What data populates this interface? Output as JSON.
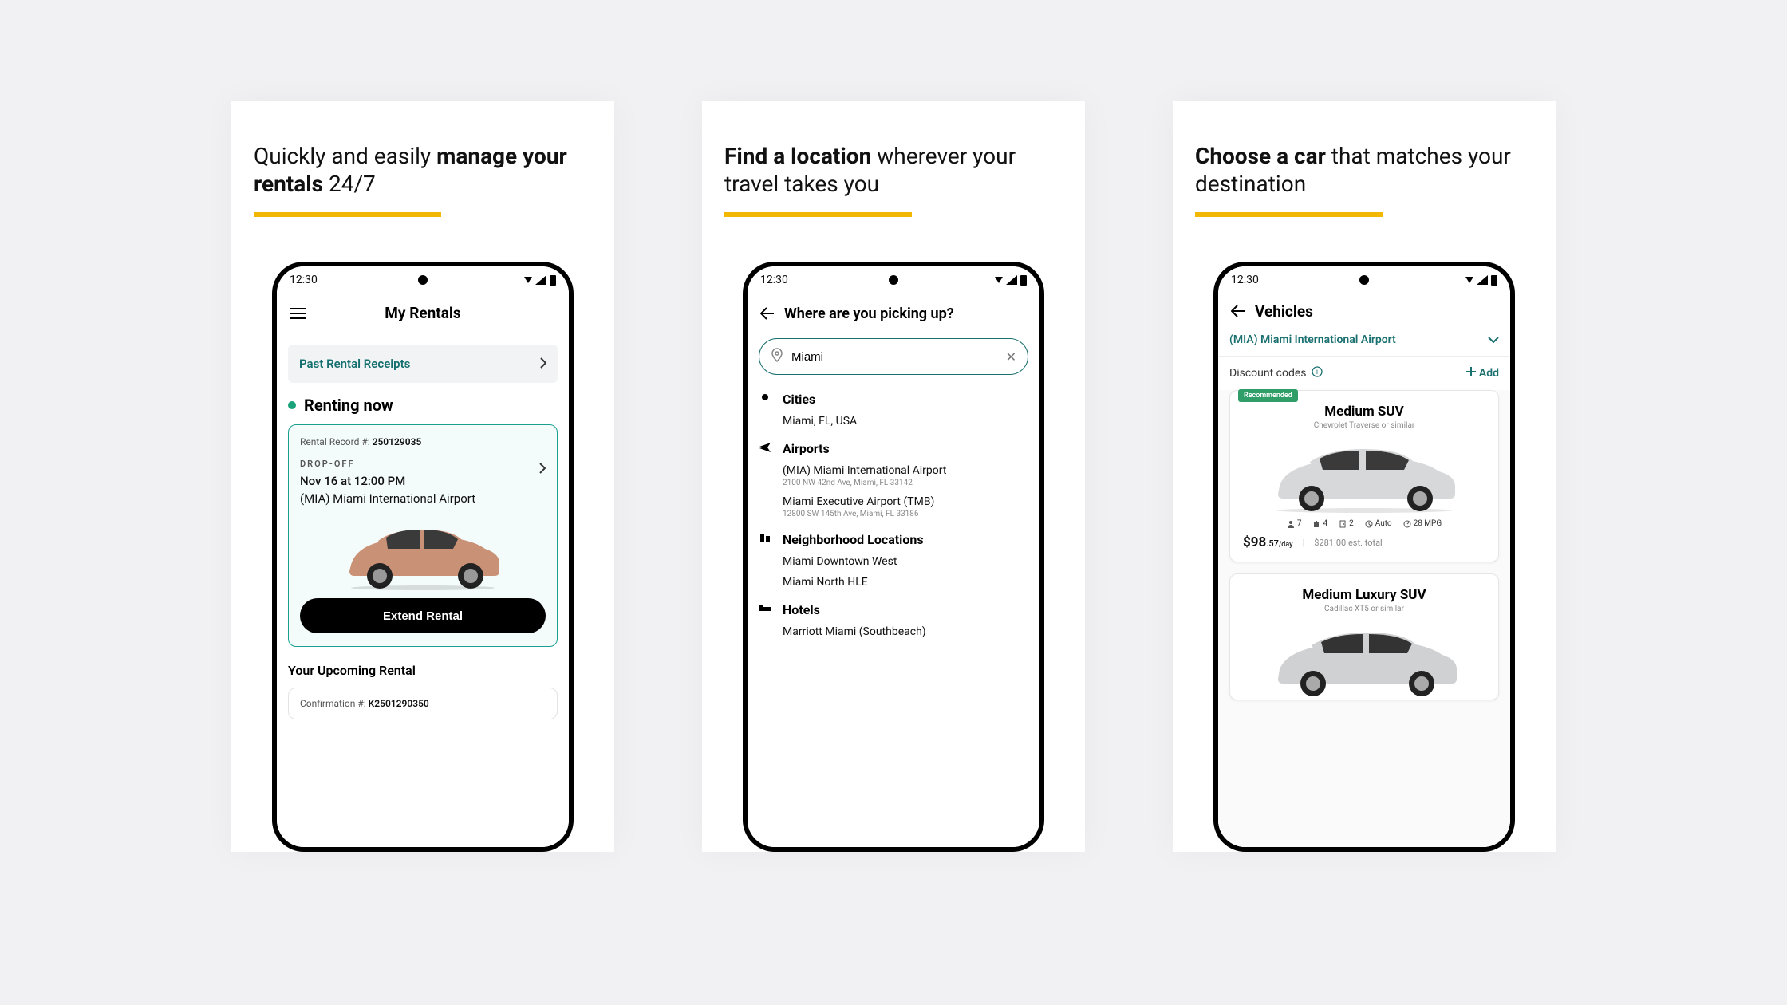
{
  "shared": {
    "statusbar_time": "12:30"
  },
  "panel1": {
    "headline_pre": "Quickly and easily ",
    "headline_bold": "manage your rentals",
    "headline_post": " 24/7",
    "screen": {
      "title": "My Rentals",
      "past_receipts": "Past Rental Receipts",
      "renting_now": "Renting now",
      "record_label": "Rental Record #: ",
      "record_num": "250129035",
      "dropoff_label": "DROP-OFF",
      "dropoff_when": "Nov 16 at 12:00 PM",
      "dropoff_loc": "(MIA) Miami International Airport",
      "extend_btn": "Extend Rental",
      "upcoming": "Your Upcoming Rental",
      "conf_label": "Confirmation #: ",
      "conf_num": "K2501290350"
    }
  },
  "panel2": {
    "headline_bold": "Find a location",
    "headline_rest": " wherever your travel takes you",
    "screen": {
      "title": "Where are you picking up?",
      "search_value": "Miami",
      "cats": {
        "cities": "Cities",
        "airports": "Airports",
        "neighborhood": "Neighborhood Locations",
        "hotels": "Hotels"
      },
      "results": {
        "city1": "Miami, FL, USA",
        "airport1": "(MIA) Miami International Airport",
        "airport1_sub": "2100 NW 42nd Ave, Miami, FL 33142",
        "airport2": "Miami Executive Airport (TMB)",
        "airport2_sub": "12800 SW 145th Ave, Miami, FL 33186",
        "hood1": "Miami Downtown West",
        "hood2": "Miami North HLE",
        "hotel1": "Marriott Miami (Southbeach)"
      }
    }
  },
  "panel3": {
    "headline_bold": "Choose a car",
    "headline_rest": " that matches your destination",
    "screen": {
      "title": "Vehicles",
      "location": "(MIA) Miami International Airport",
      "discount_label": "Discount codes",
      "add_label": "Add",
      "vehicle1": {
        "badge": "Recommended",
        "title": "Medium SUV",
        "sub": "Chevrolet Traverse or similar",
        "spec_people": "7",
        "spec_bags": "4",
        "spec_doors": "2",
        "spec_trans": "Auto",
        "spec_mpg": "28 MPG",
        "price_main": "$98",
        "price_cents": ".57",
        "price_per": "/day",
        "price_total": "$281.00 est. total"
      },
      "vehicle2": {
        "title": "Medium Luxury SUV",
        "sub": "Cadillac XT5 or similar"
      }
    }
  }
}
